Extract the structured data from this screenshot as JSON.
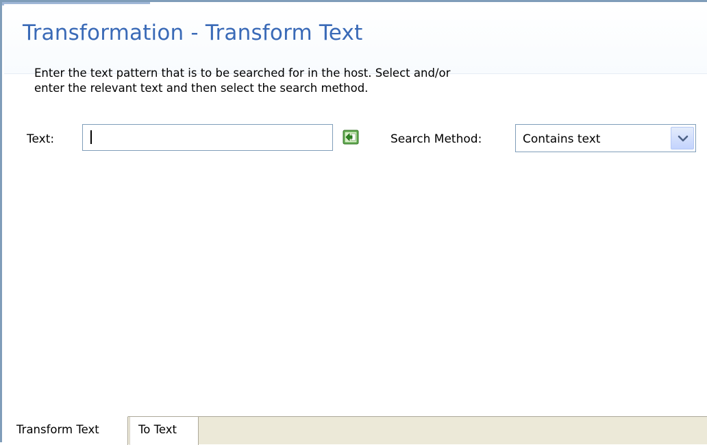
{
  "header": {
    "title": "Transformation - Transform Text"
  },
  "description": {
    "line1": "Enter the text pattern that is to be searched for in the host. Select and/or",
    "line2": "enter the relevant text and then select the search method."
  },
  "form": {
    "text_label": "Text:",
    "text_value": "",
    "insert_icon": "insert-text-icon",
    "search_method_label": "Search Method:",
    "search_method_value": "Contains text",
    "dropdown_icon": "chevron-down-icon"
  },
  "tabs": [
    {
      "label": "Transform Text",
      "active": true
    },
    {
      "label": "To Text",
      "active": false
    }
  ],
  "colors": {
    "title": "#3a6ab7",
    "border": "#7f9db9",
    "tabbar": "#ece9d8",
    "icon_green": "#3b8b2e"
  }
}
